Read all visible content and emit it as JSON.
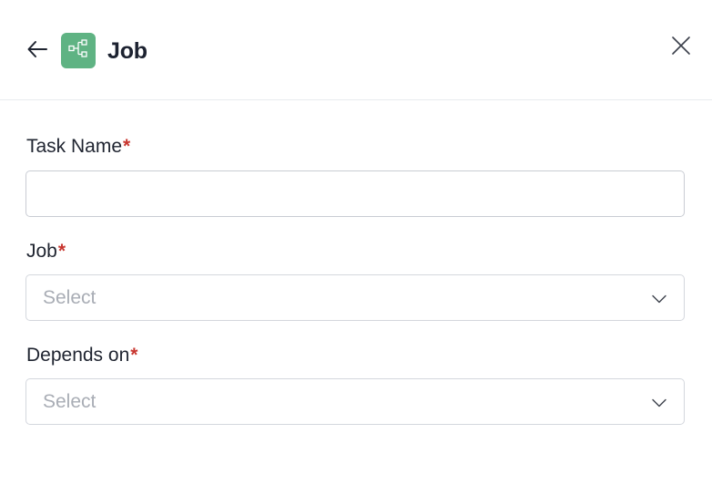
{
  "header": {
    "title": "Job",
    "back_icon": "arrow-left-icon",
    "app_icon": "workflow-icon",
    "close_icon": "close-icon",
    "app_icon_color": "#5fb383"
  },
  "form": {
    "required_marker": "*",
    "task_name": {
      "label": "Task Name",
      "value": "",
      "placeholder": ""
    },
    "job": {
      "label": "Job",
      "placeholder": "Select"
    },
    "depends_on": {
      "label": "Depends on",
      "placeholder": "Select"
    }
  },
  "colors": {
    "required": "#c8362f",
    "placeholder": "#a9adb5",
    "border": "#c9ccd3"
  }
}
